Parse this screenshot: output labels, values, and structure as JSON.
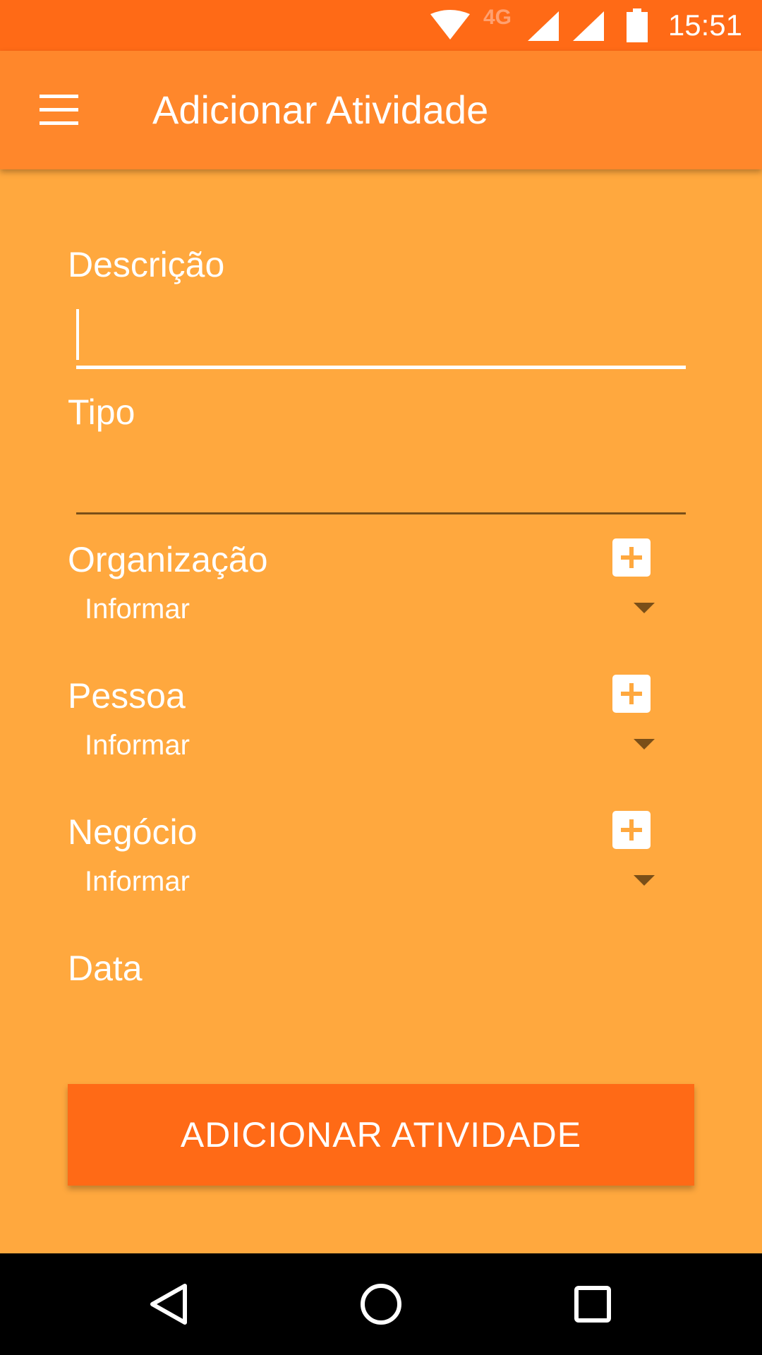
{
  "status_bar": {
    "time": "15:51",
    "network": "4G"
  },
  "app_bar": {
    "title": "Adicionar Atividade",
    "menu_icon": "hamburger-icon"
  },
  "form": {
    "descricao": {
      "label": "Descrição",
      "value": ""
    },
    "tipo": {
      "label": "Tipo",
      "value": ""
    },
    "organizacao": {
      "label": "Organização",
      "selected": "Informar"
    },
    "pessoa": {
      "label": "Pessoa",
      "selected": "Informar"
    },
    "negocio": {
      "label": "Negócio",
      "selected": "Informar"
    },
    "data": {
      "label": "Data"
    }
  },
  "submit_label": "ADICIONAR ATIVIDADE",
  "colors": {
    "status_bar": "#FF6A16",
    "app_bar": "#FF872B",
    "background": "#FFA83E",
    "button": "#FF6A16"
  },
  "nav": {
    "back_icon": "back-triangle-icon",
    "home_icon": "home-circle-icon",
    "recents_icon": "recents-square-icon"
  }
}
